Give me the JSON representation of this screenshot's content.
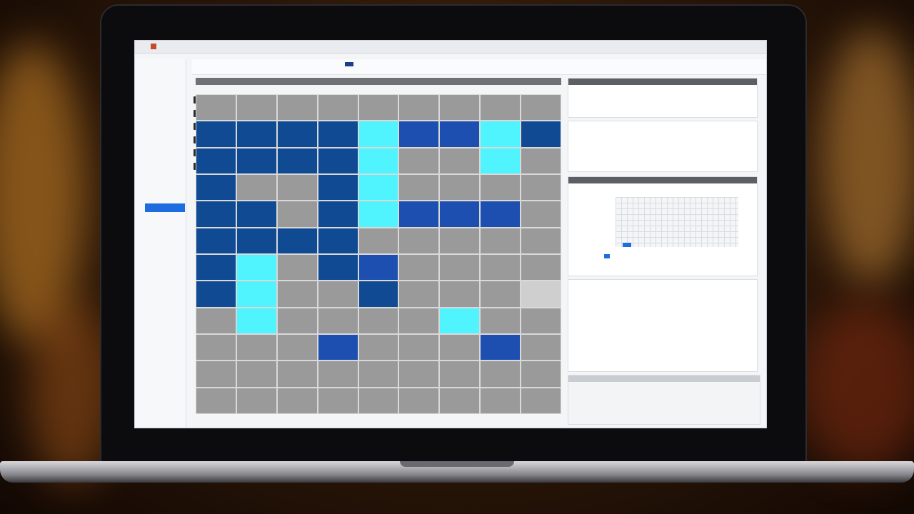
{
  "window": {
    "title_prefix": "",
    "subtitle": ""
  },
  "toolbar": {
    "right_text": "",
    "swatch_color": "#1b3f8f"
  },
  "sidebar": {
    "items": [
      "",
      "",
      "",
      "",
      "",
      "",
      "",
      "",
      "",
      "",
      "",
      "",
      "",
      "",
      "",
      "",
      ""
    ],
    "active_index": 12
  },
  "grid": {
    "header": "",
    "columns": [
      "",
      "",
      "",
      "",
      "",
      "",
      "",
      "",
      ""
    ],
    "rows": 12,
    "colors": {
      "D": "#0f4a92",
      "M": "#1d4fb0",
      "C": "#4ff4ff",
      "G": "#9a9a9a",
      "L": "#cfcfcf"
    },
    "cells": [
      [
        "G",
        "G",
        "G",
        "G",
        "G",
        "G",
        "G",
        "G",
        "G"
      ],
      [
        "D",
        "D",
        "D",
        "D",
        "C",
        "M",
        "M",
        "C",
        "D"
      ],
      [
        "D",
        "D",
        "D",
        "D",
        "C",
        "G",
        "G",
        "C",
        "G"
      ],
      [
        "D",
        "G",
        "G",
        "D",
        "C",
        "G",
        "G",
        "G",
        "G"
      ],
      [
        "D",
        "D",
        "G",
        "D",
        "C",
        "M",
        "M",
        "M",
        "G"
      ],
      [
        "D",
        "D",
        "D",
        "D",
        "G",
        "G",
        "G",
        "G",
        "G"
      ],
      [
        "D",
        "C",
        "G",
        "D",
        "M",
        "G",
        "G",
        "G",
        "G"
      ],
      [
        "D",
        "C",
        "G",
        "G",
        "D",
        "G",
        "G",
        "G",
        "L"
      ],
      [
        "G",
        "C",
        "G",
        "G",
        "G",
        "G",
        "C",
        "G",
        "G"
      ],
      [
        "G",
        "G",
        "G",
        "M",
        "G",
        "G",
        "G",
        "M",
        "G"
      ],
      [
        "G",
        "G",
        "G",
        "G",
        "G",
        "G",
        "G",
        "G",
        "G"
      ],
      [
        "G",
        "G",
        "G",
        "G",
        "G",
        "G",
        "G",
        "G",
        "G"
      ]
    ]
  },
  "panels": {
    "code_color": "#4a9a3a",
    "accent_color": "#1e6de0",
    "dark_color": "#5c5f63"
  }
}
